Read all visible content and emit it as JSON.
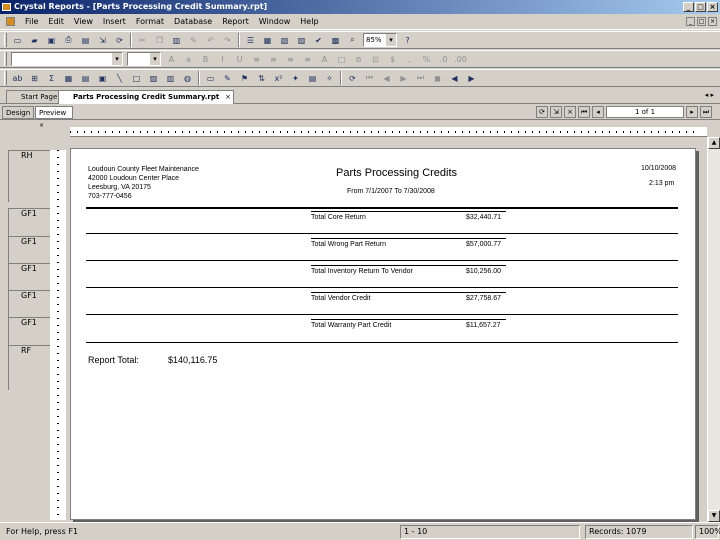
{
  "window": {
    "title": "Crystal Reports - [Parts Processing Credit Summary.rpt]"
  },
  "window_controls": {
    "minimize": "_",
    "maximize": "□",
    "close": "×"
  },
  "menu": [
    "File",
    "Edit",
    "View",
    "Insert",
    "Format",
    "Database",
    "Report",
    "Window",
    "Help"
  ],
  "toolbar": {
    "zoom": "85%",
    "font_name": "",
    "font_size": ""
  },
  "file_tabs": {
    "start": "Start Page",
    "report": "Parts Processing Credit Summary.rpt"
  },
  "view_tabs": {
    "design": "Design",
    "preview": "Preview"
  },
  "nav": {
    "page_indicator": "1 of 1"
  },
  "sections": [
    "RH",
    "GF1",
    "GF1",
    "GF1",
    "GF1",
    "GF1",
    "RF"
  ],
  "report": {
    "org_lines": [
      "Loudoun County Fleet Maintenance",
      "42000 Loudoun Center Place",
      "Leesburg, VA 20175",
      "703-777-0456"
    ],
    "title": "Parts Processing Credits",
    "date_range": "From 7/1/2007 To 7/30/2008",
    "date": "10/10/2008",
    "time": "2:13 pm",
    "rows": [
      {
        "label": "Total Core Return",
        "value": "$32,440.71"
      },
      {
        "label": "Total Wrong Part Return",
        "value": "$57,000.77"
      },
      {
        "label": "Total Inventory Return To Vendor",
        "value": "$10,256.00"
      },
      {
        "label": "Total Vendor Credit",
        "value": "$27,758.67"
      },
      {
        "label": "Total Warranty Part Credit",
        "value": "$11,657.27"
      }
    ],
    "total_label": "Report Total:",
    "total_value": "$140,116.75"
  },
  "status": {
    "help": "For Help, press F1",
    "position": "1 - 10",
    "records": "Records: 1079",
    "zoom": "100%"
  }
}
